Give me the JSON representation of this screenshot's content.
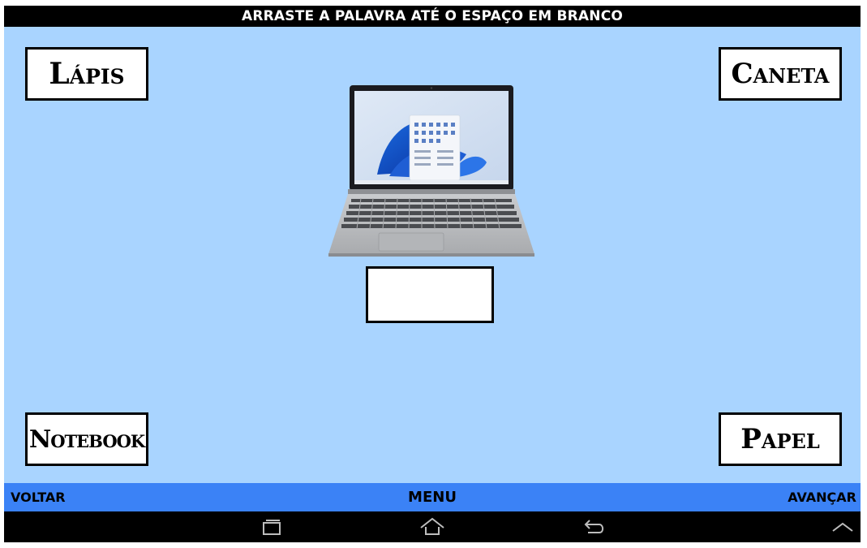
{
  "header": {
    "instruction": "ARRASTE A PALAVRA ATÉ O ESPAÇO EM BRANCO"
  },
  "words": {
    "top_left": "Lápis",
    "top_right": "Caneta",
    "bottom_left": "Notebook",
    "bottom_right": "Papel"
  },
  "navigation": {
    "back": "VOLTAR",
    "menu": "MENU",
    "next": "AVANÇAR"
  },
  "system_buttons": [
    "recent-apps-icon",
    "home-icon",
    "back-icon",
    "chevron-up-icon"
  ],
  "colors": {
    "stage": "#a9d4ff",
    "nav_bar": "#3b82f6",
    "card": "#ffffff",
    "title_bar": "#000000"
  }
}
